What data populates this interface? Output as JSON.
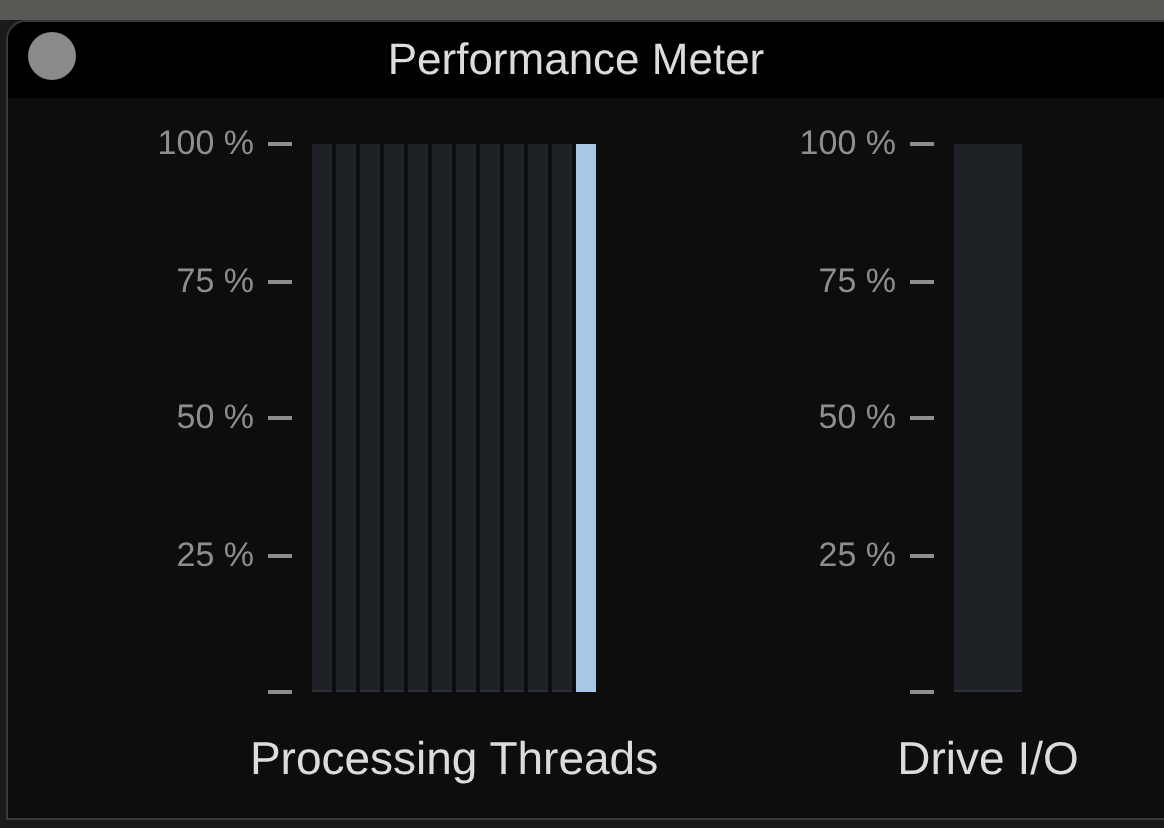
{
  "window": {
    "title": "Performance Meter"
  },
  "groups": [
    {
      "kind": "threads",
      "label": "Processing Threads",
      "ticks": [
        "100 %",
        "75 %",
        "50 %",
        "25 %"
      ],
      "meters": [
        {
          "level": 0
        },
        {
          "level": 0
        },
        {
          "level": 0
        },
        {
          "level": 0
        },
        {
          "level": 0
        },
        {
          "level": 0
        },
        {
          "level": 0
        },
        {
          "level": 0
        },
        {
          "level": 0
        },
        {
          "level": 0
        },
        {
          "level": 0
        },
        {
          "level": 1
        }
      ]
    },
    {
      "kind": "drive",
      "label": "Drive I/O",
      "ticks": [
        "100 %",
        "75 %",
        "50 %",
        "25 %"
      ],
      "meters": [
        {
          "level": 0
        }
      ]
    }
  ]
}
